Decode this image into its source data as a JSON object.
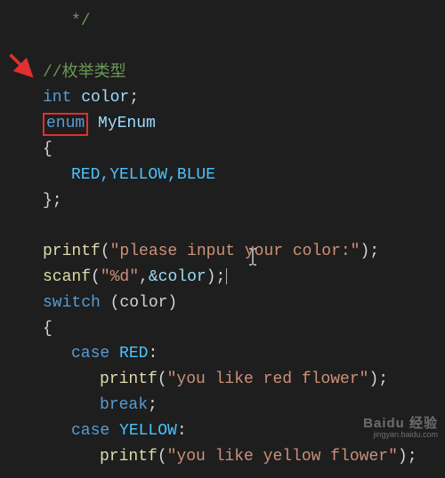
{
  "code": {
    "comment_end": "*/",
    "comment_cn": "//枚举类型",
    "int_kw": "int",
    "color_var": " color",
    "semi": ";",
    "enum_kw": "enum",
    "myenum": " MyEnum",
    "lbrace": "{",
    "enum_vals": "RED,YELLOW,BLUE",
    "rbrace_semi": "};",
    "printf": "printf",
    "lparen": "(",
    "rparen": ")",
    "str_prompt": "\"please input your color:\"",
    "scanf": "scanf",
    "str_fmt": "\"%d\"",
    "comma": ",",
    "amp_color": "&color",
    "switch_kw": "switch",
    "space_paren_color": " (color)",
    "case_kw": "case",
    "red": " RED",
    "colon": ":",
    "str_red": "\"you like red flower\"",
    "break_kw": "break",
    "yellow": " YELLOW",
    "str_yellow": "\"you like yellow flower\""
  },
  "watermark": {
    "brand": "Baidu 经验",
    "sub": "jingyan.baidu.com"
  }
}
